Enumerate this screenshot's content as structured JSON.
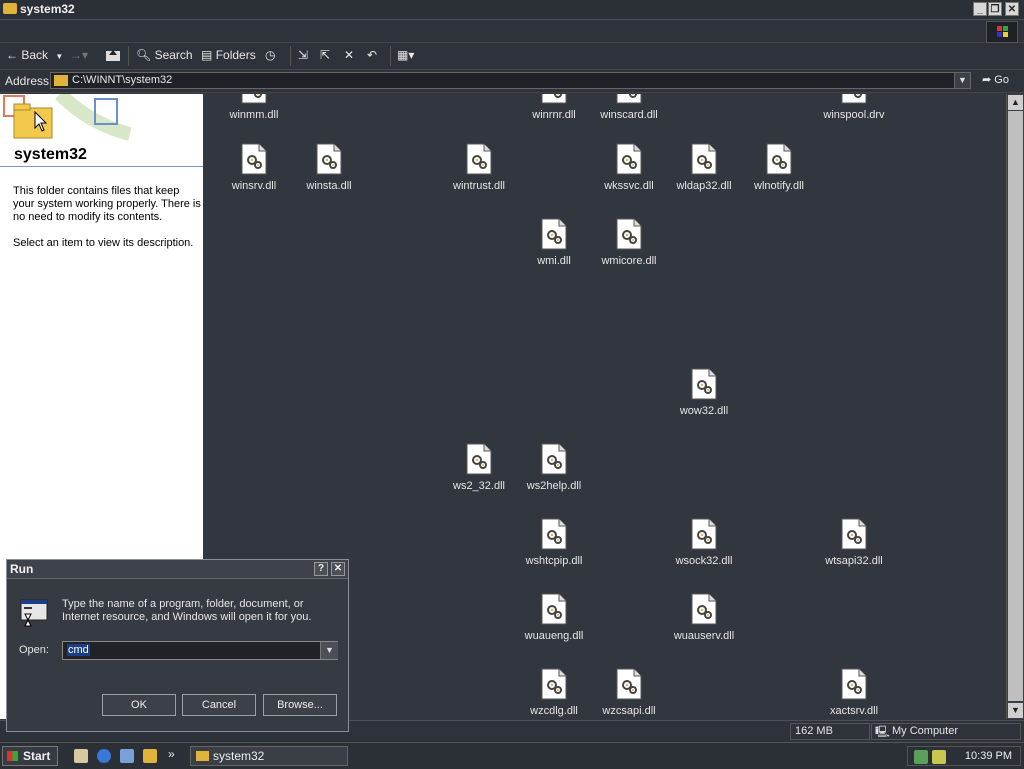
{
  "window": {
    "title": "system32"
  },
  "toolbar": {
    "back": "Back",
    "search": "Search",
    "folders": "Folders"
  },
  "address": {
    "label": "Address",
    "path": "C:\\WINNT\\system32",
    "go": "Go"
  },
  "leftpane": {
    "title": "system32",
    "description": "This folder contains files that keep your system working properly. There is no need to modify its contents.",
    "hint": "Select an item to view its description."
  },
  "files": [
    "winmm.dll",
    "winrnr.dll",
    "winscard.dll",
    "winspool.drv",
    "winsrv.dll",
    "winsta.dll",
    "wintrust.dll",
    "wkssvc.dll",
    "wldap32.dll",
    "wlnotify.dll",
    "wmi.dll",
    "wmicore.dll",
    "wow32.dll",
    "ws2_32.dll",
    "ws2help.dll",
    "wshtcpip.dll",
    "wsock32.dll",
    "wtsapi32.dll",
    "wuaueng.dll",
    "wuauserv.dll",
    "wzcdlg.dll",
    "wzcsapi.dll",
    "xactsrv.dll"
  ],
  "statusbar": {
    "size": "162 MB",
    "location": "My Computer"
  },
  "taskbar": {
    "start": "Start",
    "task": "system32",
    "clock": "10:39 PM"
  },
  "run_dialog": {
    "title": "Run",
    "help": "?",
    "description": "Type the name of a program, folder, document, or Internet resource, and Windows will open it for you.",
    "open_label": "Open:",
    "open_value": "cmd",
    "ok": "OK",
    "cancel": "Cancel",
    "browse": "Browse..."
  }
}
